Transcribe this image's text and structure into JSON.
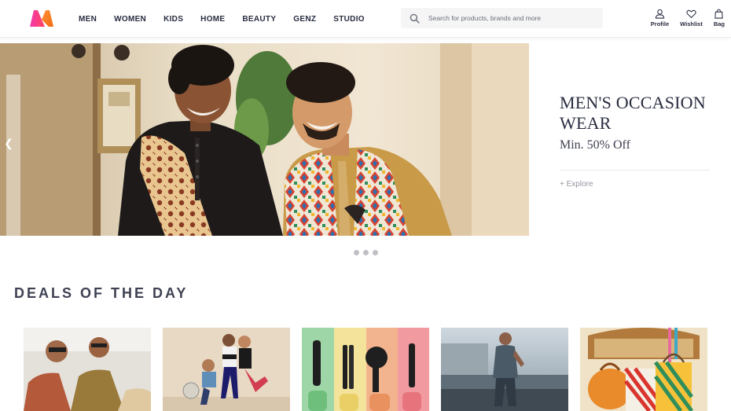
{
  "header": {
    "logo_name": "myntra-logo-icon",
    "nav": [
      "MEN",
      "WOMEN",
      "KIDS",
      "HOME",
      "BEAUTY",
      "GENZ",
      "STUDIO"
    ],
    "search_placeholder": "Search for products, brands and more",
    "actions": [
      {
        "label": "Profile",
        "icon": "profile-icon"
      },
      {
        "label": "Wishlist",
        "icon": "heart-icon"
      },
      {
        "label": "Bag",
        "icon": "bag-icon"
      }
    ],
    "brand_colors": {
      "accent": "#ff3f6c",
      "orange": "#f26a10",
      "text": "#282c3f"
    }
  },
  "hero": {
    "title": "MEN'S OCCASION WEAR",
    "subtitle": "Min. 50% Off",
    "cta": "+ Explore",
    "prev_icon": "chevron-left-icon",
    "slide_count": 3
  },
  "deals": {
    "title": "DEALS OF THE DAY",
    "cards": [
      {
        "name": "deal-card-men-shirts"
      },
      {
        "name": "deal-card-kids-wear"
      },
      {
        "name": "deal-card-hair-stylers"
      },
      {
        "name": "deal-card-men-casual"
      },
      {
        "name": "deal-card-home-bags"
      }
    ]
  }
}
